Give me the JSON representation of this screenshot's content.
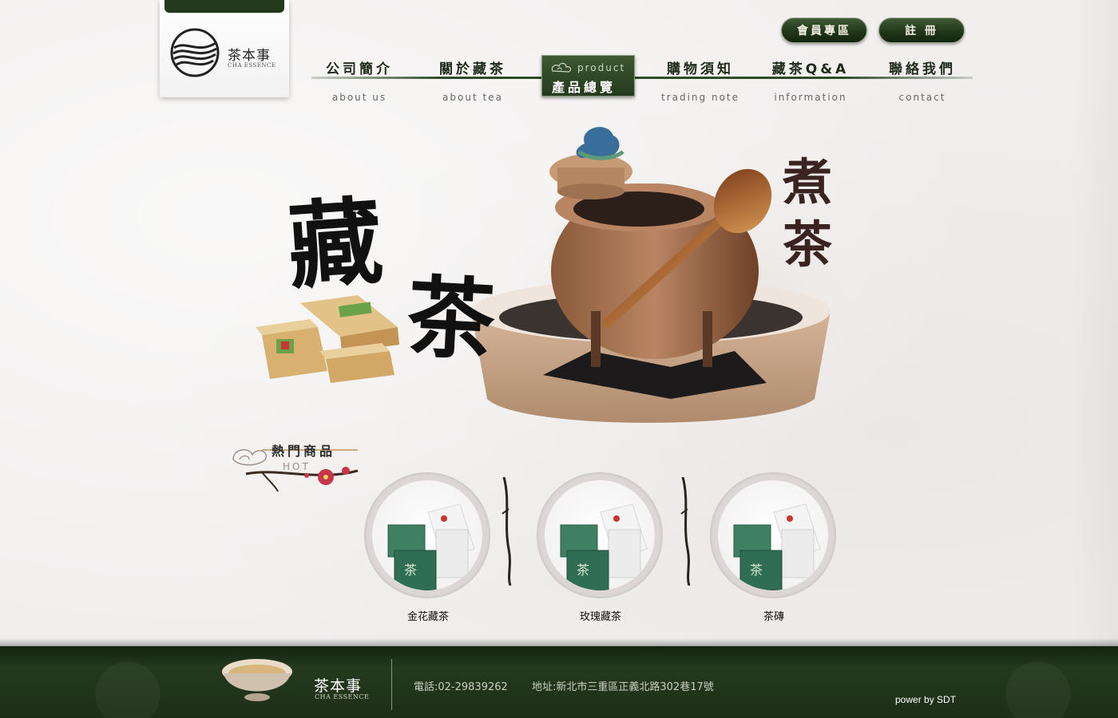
{
  "brand": {
    "name_cn": "茶本事",
    "name_en": "CHA ESSENCE"
  },
  "top_buttons": {
    "member": "會員專區",
    "register": "註 冊"
  },
  "nav": {
    "items": [
      {
        "cn": "公司簡介",
        "en": "about us"
      },
      {
        "cn": "關於藏茶",
        "en": "about tea"
      },
      {
        "cn": "產品總覽",
        "en": "product"
      },
      {
        "cn": "購物須知",
        "en": "trading  note"
      },
      {
        "cn": "藏茶Q&A",
        "en": "information"
      },
      {
        "cn": "聯絡我們",
        "en": "contact"
      }
    ],
    "active_index": 2
  },
  "hero": {
    "main_title_1": "藏",
    "main_title_2": "茶",
    "side_title_1": "煮",
    "side_title_2": "茶"
  },
  "hot": {
    "title_cn": "熱門商品",
    "title_en": "HOT",
    "products": [
      {
        "name": "金花藏茶"
      },
      {
        "name": "玫瑰藏茶"
      },
      {
        "name": "茶磚"
      }
    ]
  },
  "footer": {
    "phone": "電話:02-29839262",
    "address": "地址:新北市三重區正義北路302巷17號",
    "power": "power by SDT"
  },
  "colors": {
    "dark_green": "#233a1c",
    "footer_green": "#1f3218",
    "background": "#f1efee"
  }
}
